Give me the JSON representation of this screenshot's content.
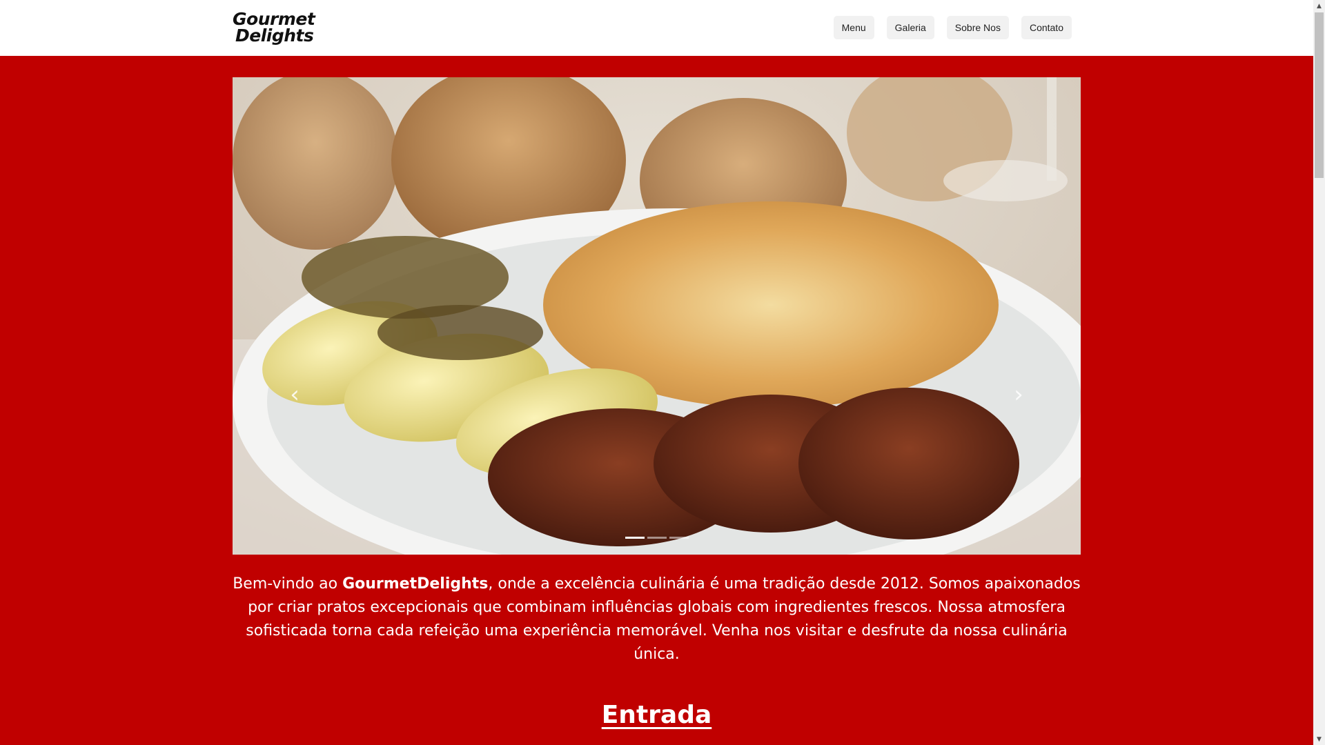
{
  "header": {
    "logo_line1": "Gourmet",
    "logo_line2": "Delights",
    "nav": [
      "Menu",
      "Galeria",
      "Sobre Nos",
      "Contato"
    ]
  },
  "carousel": {
    "prev_icon": "chevron-left-icon",
    "next_icon": "chevron-right-icon",
    "slide_count": 3,
    "active_slide": 1
  },
  "intro": {
    "part1": "Bem-vindo ao ",
    "brand": "GourmetDelights",
    "part2": ", onde a excelência culinária é uma tradição desde 2012. Somos apaixonados por criar pratos excepcionais que combinam influências globais com ingredientes frescos. Nossa atmosfera sofisticada torna cada refeição uma experiência memorável. Venha nos visitar e desfrute da nossa culinária única."
  },
  "section": {
    "title": "Entrada"
  },
  "colors": {
    "background": "#c00000",
    "header": "#ffffff",
    "nav_button": "#f1f1f1"
  }
}
